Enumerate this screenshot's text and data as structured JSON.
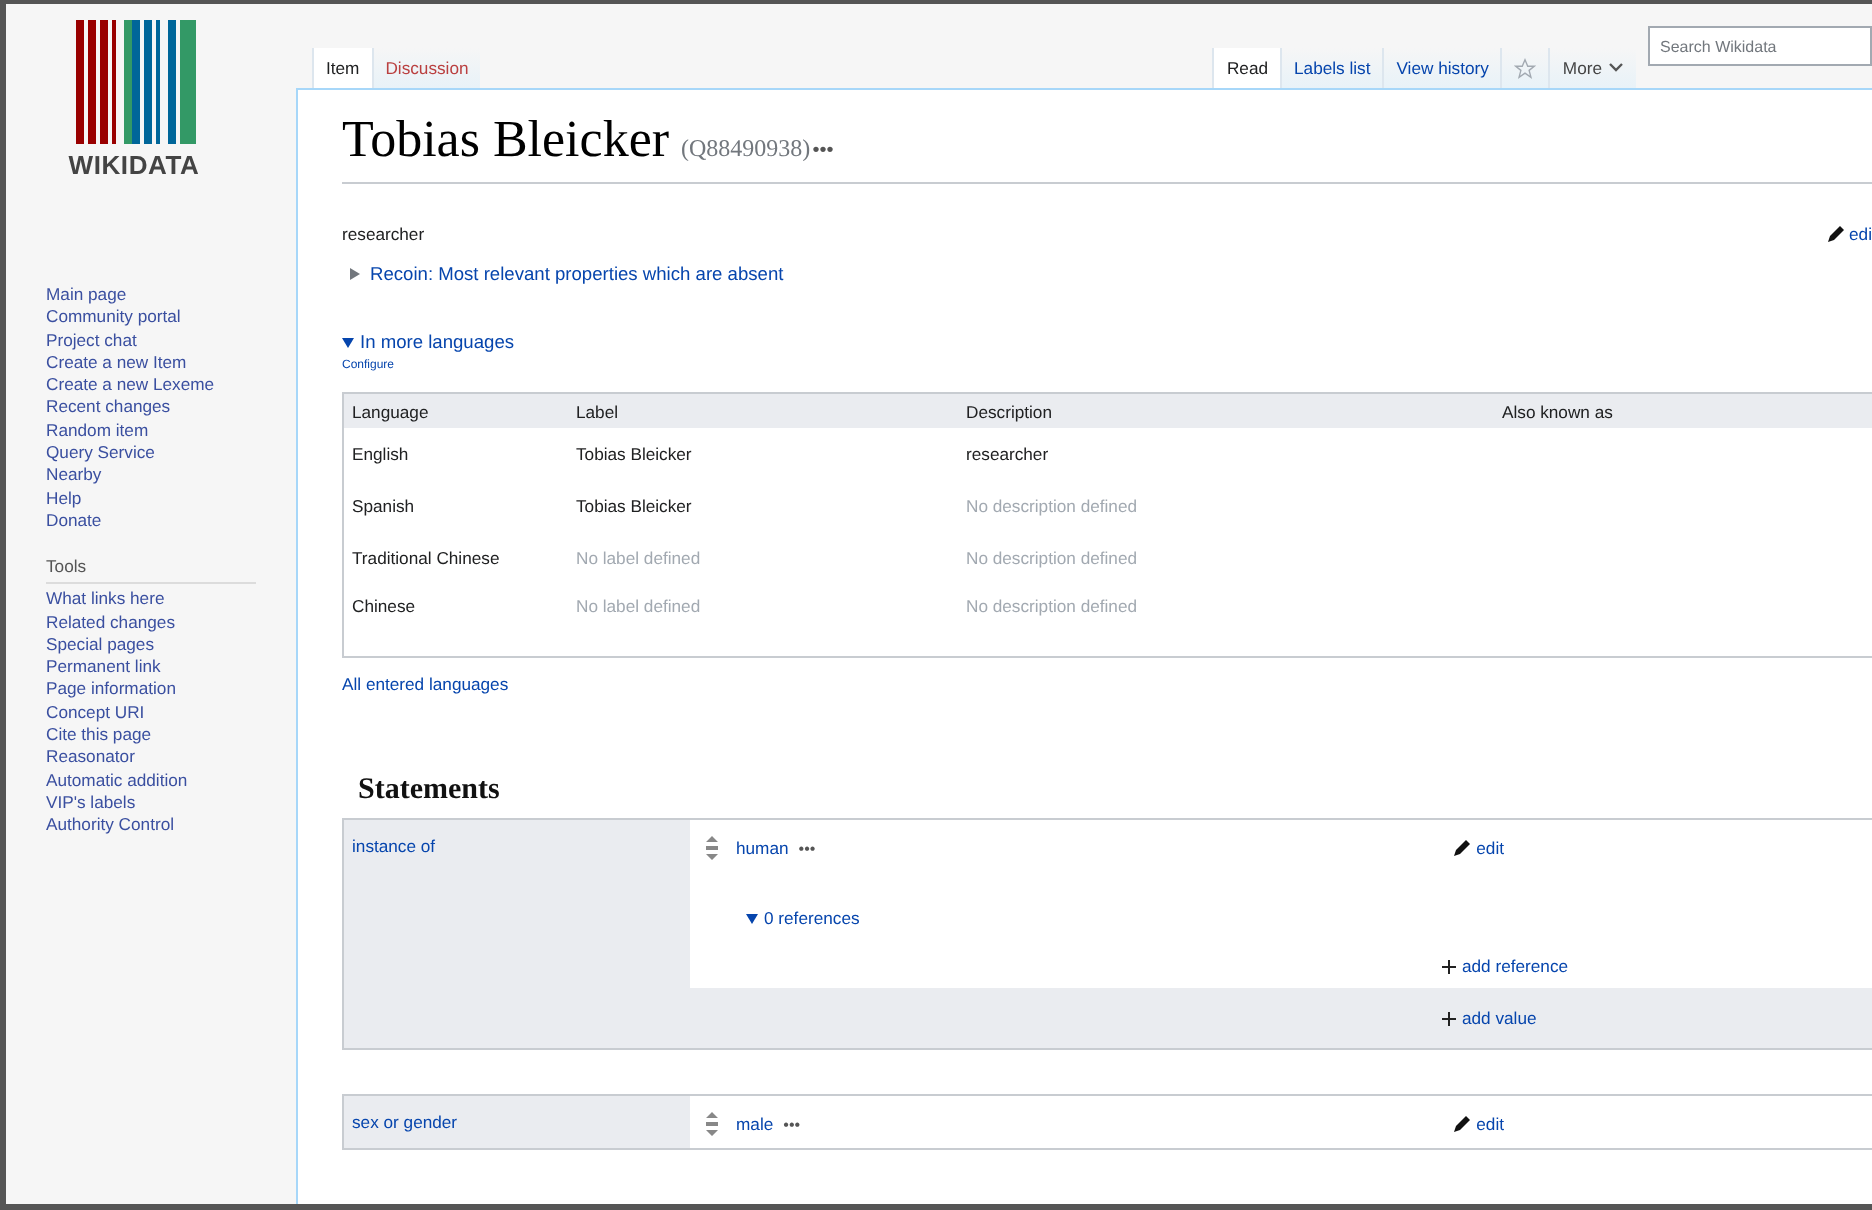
{
  "logo": {
    "wordmark": "WIKIDATA"
  },
  "sidebar": {
    "navigation": [
      "Main page",
      "Community portal",
      "Project chat",
      "Create a new Item",
      "Create a new Lexeme",
      "Recent changes",
      "Random item",
      "Query Service",
      "Nearby",
      "Help",
      "Donate"
    ],
    "tools_heading": "Tools",
    "tools": [
      "What links here",
      "Related changes",
      "Special pages",
      "Permanent link",
      "Page information",
      "Concept URI",
      "Cite this page",
      "Reasonator",
      "Automatic addition",
      "VIP's labels",
      "Authority Control"
    ]
  },
  "namespace_tabs": [
    {
      "label": "Item",
      "selected": true
    },
    {
      "label": "Discussion",
      "selected": false
    }
  ],
  "view_tabs": [
    {
      "label": "Read",
      "selected": true
    },
    {
      "label": "Labels list",
      "selected": false
    },
    {
      "label": "View history",
      "selected": false
    }
  ],
  "more_menu": "More",
  "search": {
    "placeholder": "Search Wikidata"
  },
  "title": {
    "label": "Tobias Bleicker",
    "id": "(Q88490938)",
    "ellipsis": "•••"
  },
  "description": "researcher",
  "edit_link": "edi",
  "recoin": "Recoin: Most relevant properties which are absent",
  "languages": {
    "toggle": "In more languages",
    "configure": "Configure",
    "columns": [
      "Language",
      "Label",
      "Description",
      "Also known as"
    ],
    "rows": [
      {
        "language": "English",
        "label": "Tobias Bleicker",
        "label_missing": false,
        "description": "researcher",
        "description_missing": false
      },
      {
        "language": "Spanish",
        "label": "Tobias Bleicker",
        "label_missing": false,
        "description": "No description defined",
        "description_missing": true
      },
      {
        "language": "Traditional Chinese",
        "label": "No label defined",
        "label_missing": true,
        "description": "No description defined",
        "description_missing": true
      },
      {
        "language": "Chinese",
        "label": "No label defined",
        "label_missing": true,
        "description": "No description defined",
        "description_missing": true
      }
    ],
    "all_link": "All entered languages"
  },
  "statements": {
    "heading": "Statements",
    "groups": [
      {
        "property": "instance of",
        "value": "human",
        "ellipsis": "•••",
        "edit": "edit",
        "references": "0 references",
        "add_reference": "add reference",
        "add_value": "add value"
      },
      {
        "property": "sex or gender",
        "value": "male",
        "ellipsis": "•••",
        "edit": "edit"
      }
    ]
  }
}
